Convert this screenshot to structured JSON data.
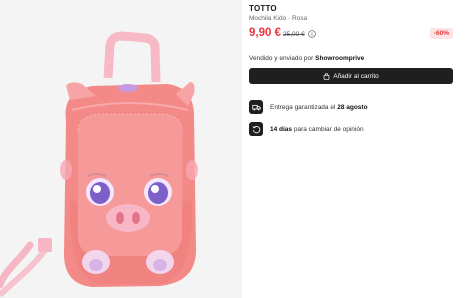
{
  "product": {
    "brand": "TOTTO",
    "subtitle": "Mochila Kido · Rosa",
    "price": "9,90 €",
    "old_price": "25,00 €",
    "discount": "-60%",
    "image_alt": "Mochila infantil rosa con forma de cerdito"
  },
  "seller": {
    "prefix": "Vendido y enviado por",
    "name": "Showroomprive"
  },
  "cart": {
    "label": "Añadir al carrito",
    "icon": "shopping-bag-icon"
  },
  "features": {
    "delivery": {
      "icon": "truck-icon",
      "prefix": "Entrega garantizada el",
      "bold": "28 agosto"
    },
    "returns": {
      "icon": "return-icon",
      "bold": "14 días",
      "suffix": "para cambiar de opinión"
    }
  },
  "colors": {
    "price": "#e8363d",
    "discount_bg": "#fde3e3",
    "button_bg": "#1f1f1f",
    "image_bg": "#f4f4f4",
    "bag_pink": "#f48a87"
  }
}
